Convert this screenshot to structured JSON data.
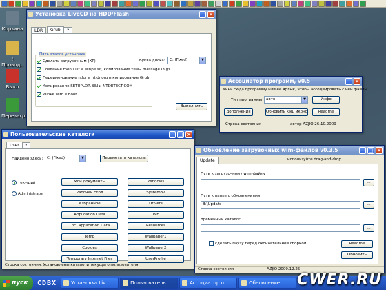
{
  "desktop": {
    "icons": [
      {
        "label": "Корзина",
        "color": "#6a7d8c"
      },
      {
        "label": "!Провод..",
        "color": "#d8b44a"
      },
      {
        "label": "Выкл",
        "color": "#c8322a"
      },
      {
        "label": "Перезагр",
        "color": "#3a9a3a"
      }
    ]
  },
  "quickbar": {
    "icon_colors": [
      "#3a6ec8",
      "#d04020",
      "#40a040",
      "#e8c030",
      "#8040c0",
      "#20a0c0",
      "#c06020",
      "#3050a0",
      "#a0a0a0",
      "#d0d040",
      "#6080c0",
      "#c04080",
      "#40c080",
      "#8080c0",
      "#c0c040",
      "#4040a0",
      "#a04040",
      "#40a0a0",
      "#e07030",
      "#7070d0",
      "#30a050",
      "#b0b030",
      "#5050c0",
      "#c05050",
      "#50c0c0",
      "#906030",
      "#3070c0",
      "#c0a040",
      "#6040a0",
      "#a06040",
      "#40a060",
      "#d0d0d0",
      "#3a6ec8",
      "#d04020",
      "#40a040",
      "#e8c030",
      "#8040c0",
      "#20a0c0",
      "#c06020",
      "#3050a0",
      "#a0a0a0",
      "#d0d040",
      "#6080c0",
      "#c04080",
      "#40c080",
      "#8080c0",
      "#c0c040",
      "#4040a0",
      "#a04040",
      "#40a0a0",
      "#e07030",
      "#7070d0",
      "#30a050"
    ]
  },
  "install_window": {
    "title": "Установка LiveCD на HDD/Flash",
    "tabs": [
      "LDR",
      "Grub",
      "?"
    ],
    "group_title": "Пять этапов установки",
    "steps": [
      {
        "label": "Сделать загрузочным (XP)",
        "checked": true
      },
      {
        "label": "Создание menu.lst и winpe.sif, копирование темы message33.gz",
        "checked": true
      },
      {
        "label": "Переименование ntldr в ntldr.org и копирование Grub",
        "checked": true
      },
      {
        "label": "Копирование SETUPLDR.BIN и NTDETECT.COM",
        "checked": true
      },
      {
        "label": "WinPe.wim в Boot",
        "checked": true
      }
    ],
    "drive_label": "Буква диска:",
    "drive_value": "C: (Fixed)",
    "run_button": "Выполнить"
  },
  "assoc_window": {
    "title": "Ассоциатор программ, v0.5",
    "hint": "Кинь сюда программу или её ярлык, чтобы ассоциировать с ней файлы",
    "type_label": "Тип программы",
    "type_value": "авто",
    "info_button": "Инфо",
    "btn_more": "дополнения",
    "btn_refresh": "Обновить кэш иконок",
    "btn_readme": "Readme",
    "status_label": "Строка состояния",
    "status_value": "автор AZJIO 26.10.2009"
  },
  "folders_window": {
    "title": "Пользовательские каталоги",
    "tabs": [
      "User",
      "?"
    ],
    "found_label": "Найдено здесь:",
    "found_value": "C: (Fixed)",
    "relocate_button": "Переметать каталоги",
    "radio_current": "текущий",
    "radio_admin": "Administrator",
    "left_buttons": [
      "Мои документы",
      "Рабочий стол",
      "Избранное",
      "Application Data",
      "Loc. Application Data",
      "Temp",
      "Cookies",
      "Temporary Internet Files"
    ],
    "right_buttons": [
      "Windows",
      "System32",
      "Drivers",
      "INF",
      "Resources",
      "Wallpaper1",
      "Wallpaper2",
      "UserProfile"
    ],
    "status": "Строка состояния. Установлены каталоги текущего пользователя."
  },
  "update_window": {
    "title": "Обновление загрузочных wim-файлов v0.3.5",
    "tab": "Update",
    "dragdrop": "используйте drag-and-drop",
    "wim_label": "Путь к загрузочному wim-файлу",
    "wim_value": "",
    "upd_label": "Путь к папке с обновлениями",
    "upd_value": "B:\\Update",
    "tmp_label": "Временный каталог",
    "tmp_value": "",
    "pause_label": "сделать паузу перед окончательной сборкой",
    "readme_button": "Readme",
    "update_button": "Обновить",
    "status_label": "Строка состояния",
    "status_value": "AZJIO 2009.12.25"
  },
  "taskbar": {
    "start_label": "пуск",
    "quick": "CDBX",
    "buttons": [
      "Установка Liv...",
      "Пользователь...",
      "Ассоциатор п...",
      "Обновление..."
    ],
    "watermark": "CWER.RU"
  }
}
